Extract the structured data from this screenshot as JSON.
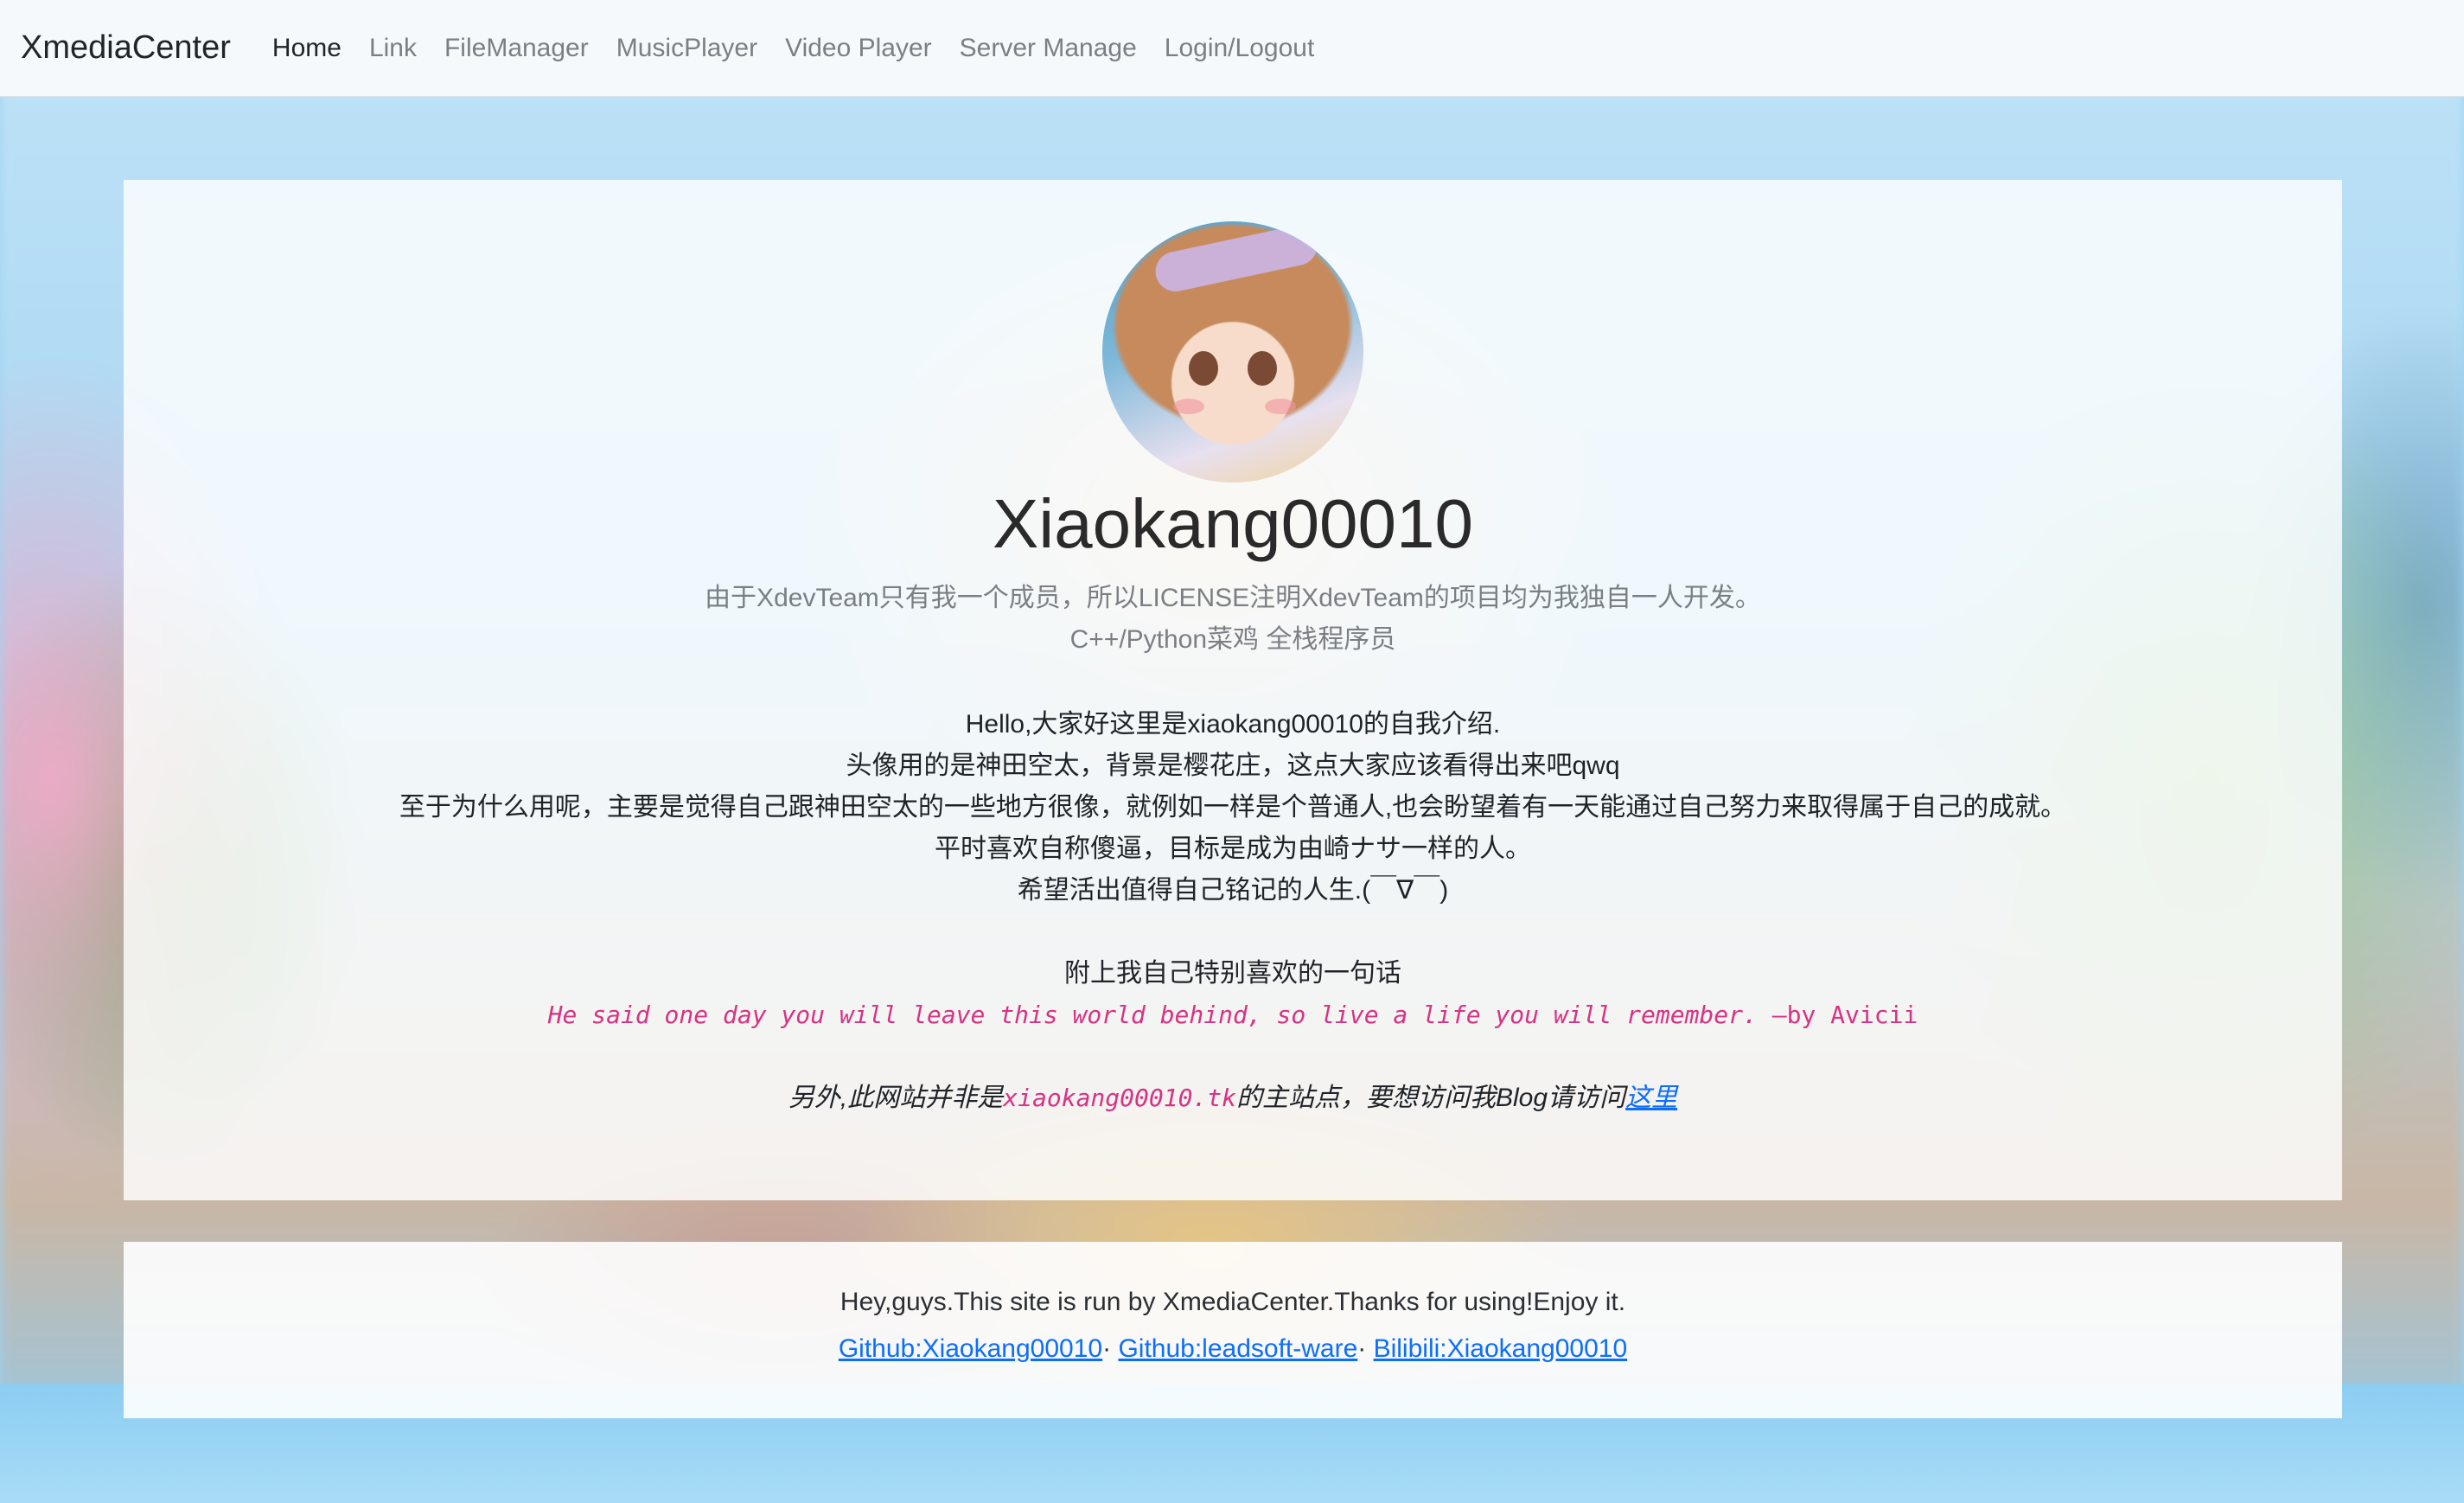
{
  "navbar": {
    "brand": "XmediaCenter",
    "items": [
      {
        "label": "Home",
        "active": true
      },
      {
        "label": "Link"
      },
      {
        "label": "FileManager"
      },
      {
        "label": "MusicPlayer"
      },
      {
        "label": "Video Player"
      },
      {
        "label": "Server Manage"
      },
      {
        "label": "Login/Logout"
      }
    ]
  },
  "profile": {
    "name": "Xiaokang00010",
    "lead": [
      "由于XdevTeam只有我一个成员，所以LICENSE注明XdevTeam的项目均为我独自一人开发。",
      "C++/Python菜鸡 全栈程序员"
    ],
    "intro": [
      "Hello,大家好这里是xiaokang00010的自我介绍.",
      "头像用的是神田空太，背景是樱花庄，这点大家应该看得出来吧qwq",
      "至于为什么用呢，主要是觉得自己跟神田空太的一些地方很像，就例如一样是个普通人,也会盼望着有一天能通过自己努力来取得属于自己的成就。",
      "平时喜欢自称傻逼，目标是成为由崎ナサ一样的人。",
      "希望活出值得自己铭记的人生.(￣∇￣)"
    ],
    "quote_title": "附上我自己特别喜欢的一句话",
    "quote_text": "He said one day you will leave this world behind, so live a life you will remember.",
    "quote_by": " —by Avicii",
    "other_prefix": "另外,此网站并非是",
    "other_domain": "xiaokang00010.tk",
    "other_middle": "的主站点，要想访问我Blog请访问",
    "other_link": "这里"
  },
  "footer": {
    "text": "Hey,guys.This site is run by XmediaCenter.Thanks for using!Enjoy it.",
    "links": [
      {
        "label": "Github:Xiaokang00010"
      },
      {
        "label": "Github:leadsoft-ware"
      },
      {
        "label": "Bilibili:Xiaokang00010"
      }
    ],
    "separator": "·"
  }
}
